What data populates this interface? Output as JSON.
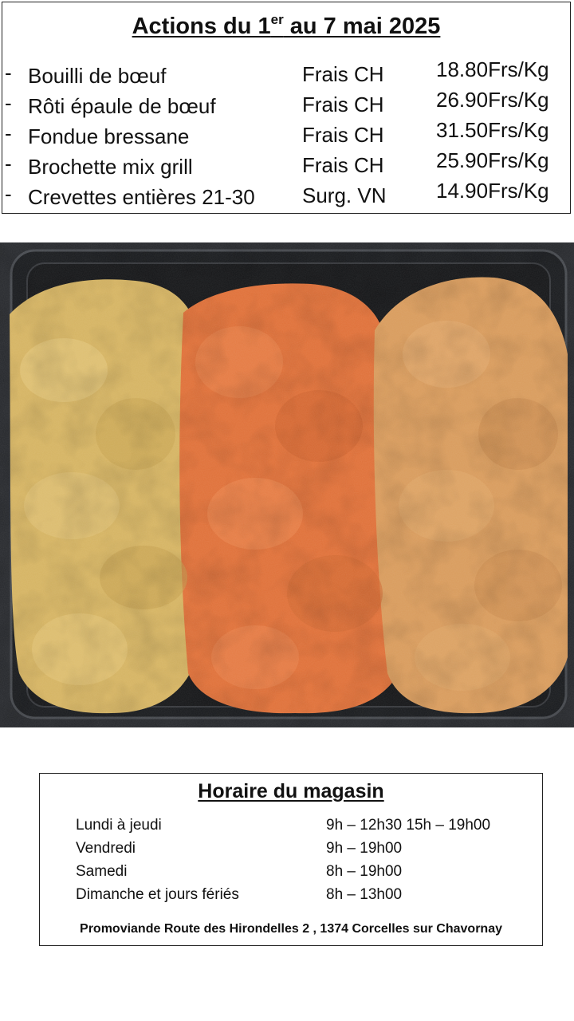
{
  "promo": {
    "title_prefix": "Actions du 1",
    "title_sup": "er",
    "title_suffix": " au 7 mai 2025",
    "items": [
      {
        "dash": "-",
        "name": "Bouilli de bœuf",
        "origin": "Frais CH",
        "price": "18.80Frs/Kg"
      },
      {
        "dash": "-",
        "name": "Rôti épaule de bœuf",
        "origin": "Frais CH",
        "price": "26.90Frs/Kg"
      },
      {
        "dash": "-",
        "name": "Fondue bressane",
        "origin": "Frais CH",
        "price": "31.50Frs/Kg"
      },
      {
        "dash": "-",
        "name": "Brochette mix grill",
        "origin": "Frais CH",
        "price": "25.90Frs/Kg"
      },
      {
        "dash": "-",
        "name": "Crevettes entières 21-30",
        "origin": "Surg. VN",
        "price": "14.90Frs/Kg"
      }
    ]
  },
  "photo": {
    "subject": "breaded-meat-tray",
    "colors": {
      "tray": "#2a2c30",
      "left": "#d7b867",
      "middle": "#e2773f",
      "right": "#dba063"
    }
  },
  "hours": {
    "title": "Horaire du magasin",
    "rows": [
      {
        "day": "Lundi à jeudi",
        "time": "9h – 12h30  15h – 19h00"
      },
      {
        "day": "Vendredi",
        "time": "9h – 19h00"
      },
      {
        "day": "Samedi",
        "time": "8h – 19h00"
      },
      {
        "day": "Dimanche et jours fériés",
        "time": "8h – 13h00"
      }
    ],
    "address": "Promoviande Route des Hirondelles 2 , 1374 Corcelles sur Chavornay"
  }
}
